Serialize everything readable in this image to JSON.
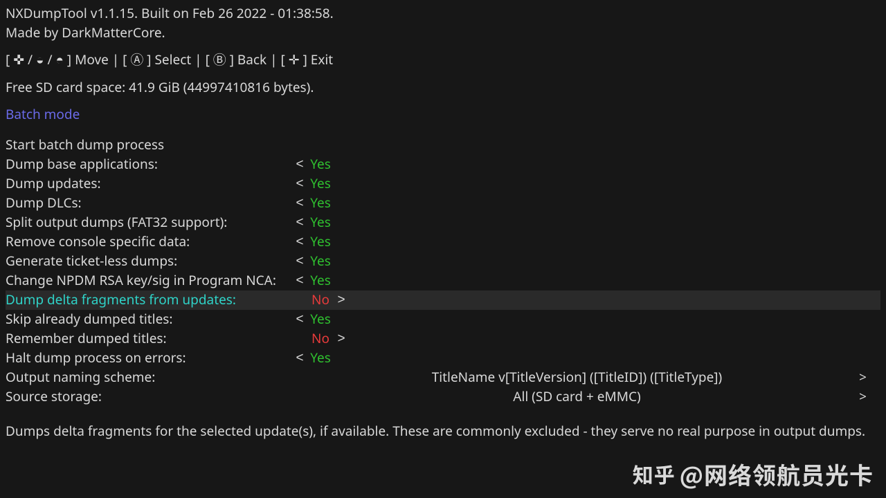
{
  "header": {
    "title_line": "NXDumpTool v1.1.15. Built on Feb 26 2022 - 01:38:58.",
    "author_line": "Made by DarkMatterCore.",
    "controls_line": "[ ✜ / ◒ / ◓ ] Move | [ Ⓐ ] Select | [ Ⓑ ] Back | [ ✛ ] Exit",
    "space_line": "Free SD card space: 41.9 GiB (44997410816 bytes).",
    "mode": "Batch mode"
  },
  "menu": {
    "start": "Start batch dump process",
    "options": [
      {
        "label": "Dump base applications:",
        "value": "Yes",
        "left": true,
        "right": false,
        "selected": false
      },
      {
        "label": "Dump updates:",
        "value": "Yes",
        "left": true,
        "right": false,
        "selected": false
      },
      {
        "label": "Dump DLCs:",
        "value": "Yes",
        "left": true,
        "right": false,
        "selected": false
      },
      {
        "label": "Split output dumps (FAT32 support):",
        "value": "Yes",
        "left": true,
        "right": false,
        "selected": false
      },
      {
        "label": "Remove console specific data:",
        "value": "Yes",
        "left": true,
        "right": false,
        "selected": false
      },
      {
        "label": "Generate ticket-less dumps:",
        "value": "Yes",
        "left": true,
        "right": false,
        "selected": false
      },
      {
        "label": "Change NPDM RSA key/sig in Program NCA:",
        "value": "Yes",
        "left": true,
        "right": false,
        "selected": false
      },
      {
        "label": "Dump delta fragments from updates:",
        "value": "No",
        "left": false,
        "right": true,
        "selected": true
      },
      {
        "label": "Skip already dumped titles:",
        "value": "Yes",
        "left": true,
        "right": false,
        "selected": false
      },
      {
        "label": "Remember dumped titles:",
        "value": "No",
        "left": false,
        "right": true,
        "selected": false
      },
      {
        "label": "Halt dump process on errors:",
        "value": "Yes",
        "left": true,
        "right": false,
        "selected": false
      }
    ],
    "wide_options": [
      {
        "label": "Output naming scheme:",
        "value": "TitleName v[TitleVersion] ([TitleID]) ([TitleType])"
      },
      {
        "label": "Source storage:",
        "value": "All (SD card + eMMC)"
      }
    ]
  },
  "hint": "Dumps delta fragments for the selected update(s), if available. These are commonly excluded - they serve no real purpose in output dumps.",
  "watermark": {
    "prefix": "知乎",
    "text": "@网络领航员光卡"
  },
  "arrows": {
    "left": "<",
    "right": ">"
  }
}
